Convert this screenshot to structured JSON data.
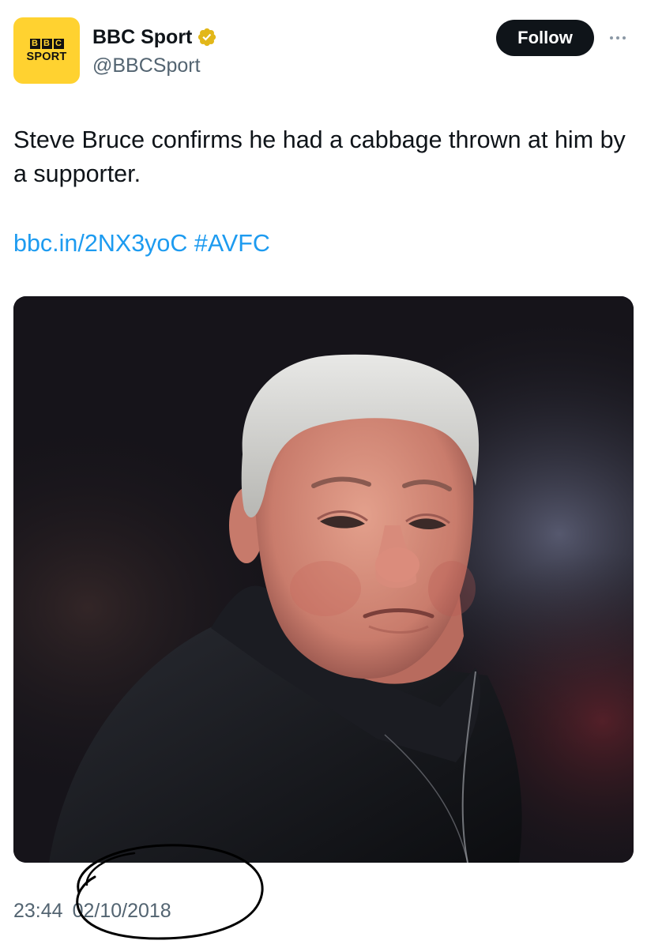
{
  "account": {
    "avatar_top": [
      "B",
      "B",
      "C"
    ],
    "avatar_bottom": "SPORT",
    "display_name": "BBC Sport",
    "handle": "@BBCSport",
    "verified_icon": "gold-verified-badge-icon"
  },
  "actions": {
    "follow_label": "Follow",
    "more_icon": "more-dots-icon"
  },
  "tweet": {
    "text": "Steve Bruce confirms he had a cabbage thrown at him by a supporter.",
    "link": "bbc.in/2NX3yoC",
    "hashtag": "#AVFC"
  },
  "footer": {
    "time": "23:44",
    "date": "02/10/2018"
  },
  "colors": {
    "avatar_bg": "#ffd230",
    "follow_bg": "#0f1419",
    "link": "#1d9bf0",
    "secondary_text": "#536471",
    "verified": "#e2b719"
  }
}
